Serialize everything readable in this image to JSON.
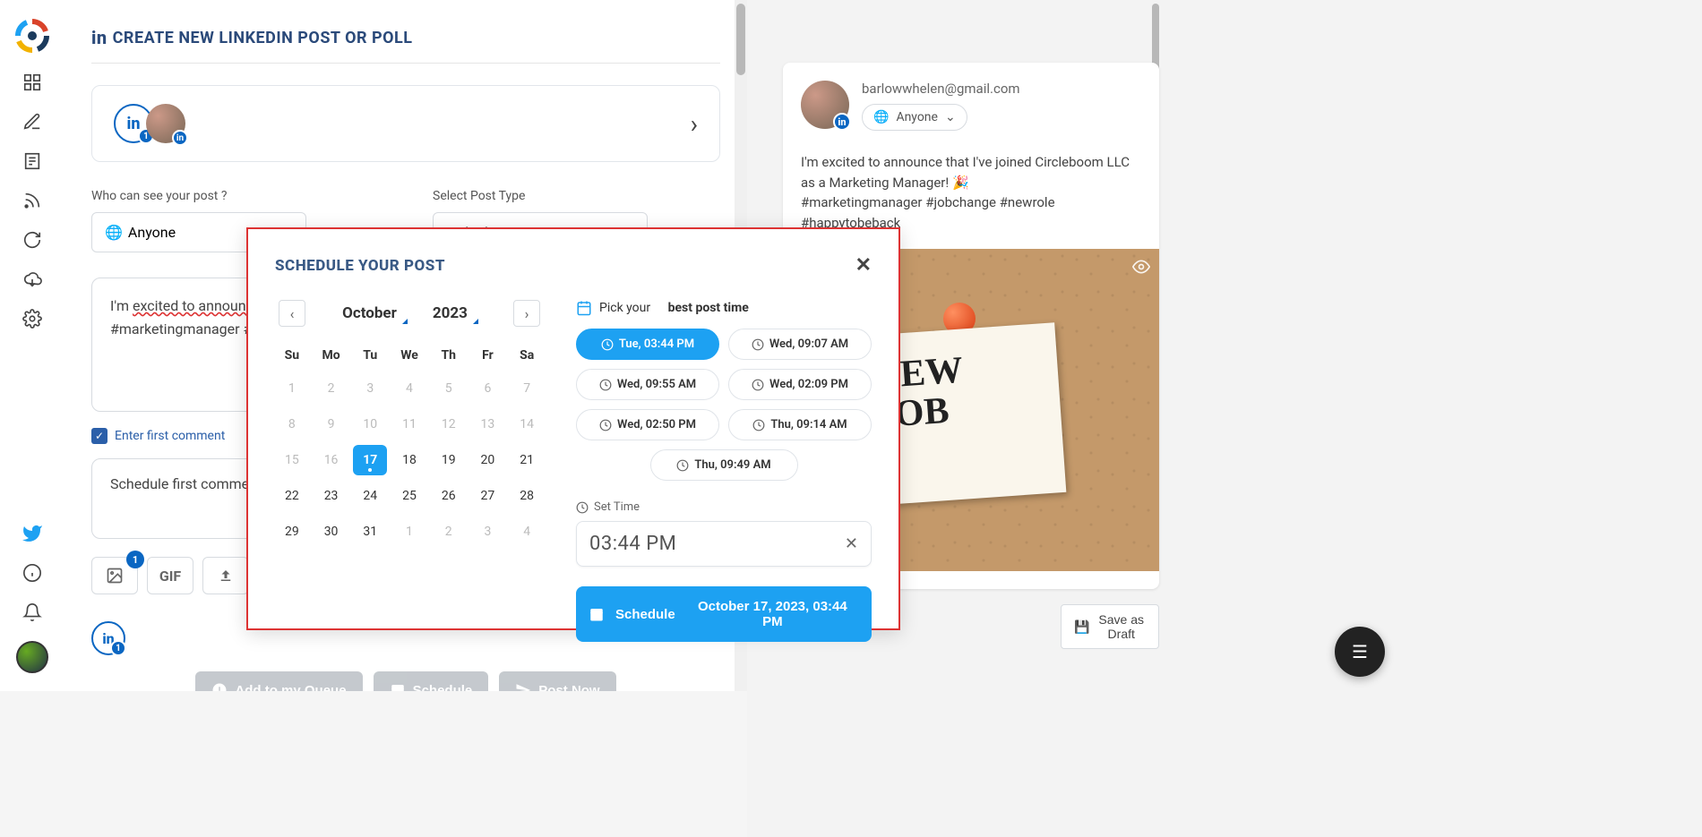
{
  "page": {
    "title": "CREATE NEW LINKEDIN POST OR POLL",
    "visibility_label": "Who can see your post ?",
    "visibility_value": "Anyone",
    "type_label": "Select Post Type",
    "type_value": "LinkedIn Post",
    "post_text_prefix": "I'm ",
    "post_text_wavy1": "excited to announce",
    "post_text_line2_prefix": "#marketingmanager #j",
    "first_comment_checkbox": "Enter first comment",
    "first_comment_placeholder_prefix": "Schedule ",
    "first_comment_placeholder_wavy": "first comment",
    "gif_label": "GIF",
    "media_badge": "1",
    "account_badge": "1"
  },
  "actions": {
    "queue": "Add to my Queue",
    "schedule": "Schedule",
    "post_now": "Post Now"
  },
  "preview": {
    "email": "barlowwhelen@gmail.com",
    "audience": "Anyone",
    "text": "I'm excited to announce that I've joined Circleboom LLC as a Marketing Manager! 🎉\n#marketingmanager #jobchange #newrole #happytobeback",
    "sticky_line1": "NEW",
    "sticky_line2": "JOB",
    "save_draft": "Save as Draft"
  },
  "modal": {
    "title": "SCHEDULE YOUR POST",
    "month": "October",
    "year": "2023",
    "dows": [
      "Su",
      "Mo",
      "Tu",
      "We",
      "Th",
      "Fr",
      "Sa"
    ],
    "days": [
      {
        "n": "1",
        "d": true
      },
      {
        "n": "2",
        "d": true
      },
      {
        "n": "3",
        "d": true
      },
      {
        "n": "4",
        "d": true
      },
      {
        "n": "5",
        "d": true
      },
      {
        "n": "6",
        "d": true
      },
      {
        "n": "7",
        "d": true
      },
      {
        "n": "8",
        "d": true
      },
      {
        "n": "9",
        "d": true
      },
      {
        "n": "10",
        "d": true
      },
      {
        "n": "11",
        "d": true
      },
      {
        "n": "12",
        "d": true
      },
      {
        "n": "13",
        "d": true
      },
      {
        "n": "14",
        "d": true
      },
      {
        "n": "15",
        "d": true
      },
      {
        "n": "16",
        "d": true
      },
      {
        "n": "17",
        "today": true
      },
      {
        "n": "18"
      },
      {
        "n": "19"
      },
      {
        "n": "20"
      },
      {
        "n": "21"
      },
      {
        "n": "22"
      },
      {
        "n": "23"
      },
      {
        "n": "24"
      },
      {
        "n": "25"
      },
      {
        "n": "26"
      },
      {
        "n": "27"
      },
      {
        "n": "28"
      },
      {
        "n": "29"
      },
      {
        "n": "30"
      },
      {
        "n": "31"
      },
      {
        "n": "1",
        "d": true
      },
      {
        "n": "2",
        "d": true
      },
      {
        "n": "3",
        "d": true
      },
      {
        "n": "4",
        "d": true
      }
    ],
    "pick_prefix": "Pick your",
    "pick_bold": "best post time",
    "times": [
      {
        "t": "Tue, 03:44 PM",
        "active": true
      },
      {
        "t": "Wed, 09:07 AM"
      },
      {
        "t": "Wed, 09:55 AM"
      },
      {
        "t": "Wed, 02:09 PM"
      },
      {
        "t": "Wed, 02:50 PM"
      },
      {
        "t": "Thu, 09:14 AM"
      },
      {
        "t": "Thu, 09:49 AM",
        "solo": true
      }
    ],
    "set_time_label": "Set Time",
    "time_value": "03:44 PM",
    "schedule_label": "Schedule",
    "schedule_date": "October 17, 2023, 03:44 PM"
  },
  "colors": {
    "accent": "#1da1f2",
    "linkedin": "#0a66c2",
    "modal_border": "#d33"
  }
}
